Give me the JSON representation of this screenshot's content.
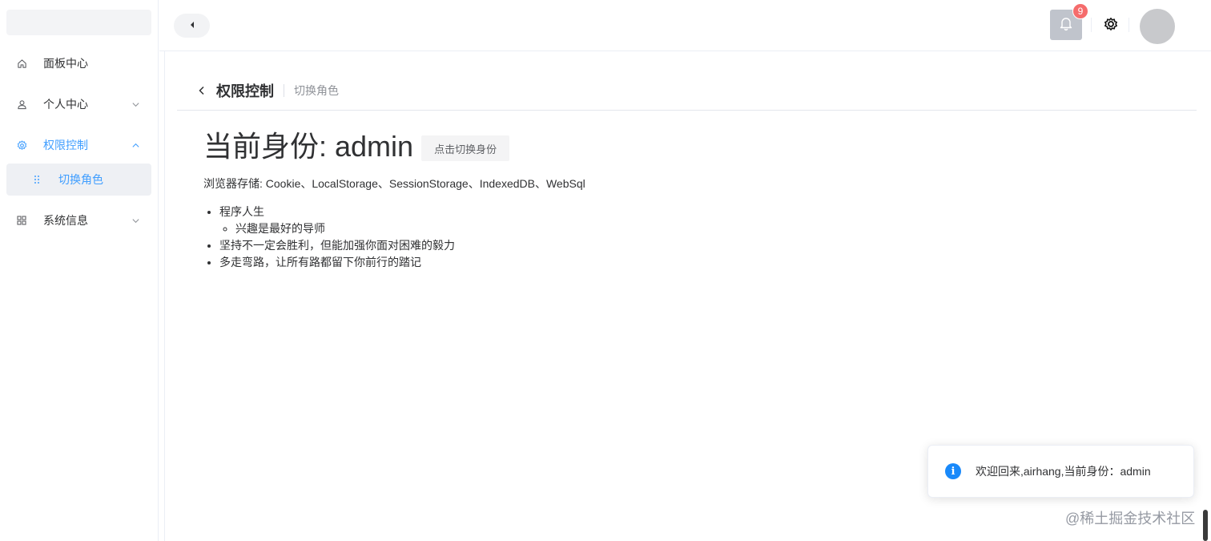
{
  "sidebar": {
    "items": [
      {
        "label": "面板中心",
        "icon": "home-icon"
      },
      {
        "label": "个人中心",
        "icon": "user-icon",
        "arrow": "chevron-down-icon"
      },
      {
        "label": "权限控制",
        "icon": "gear-icon",
        "arrow": "chevron-up-icon",
        "active": true
      },
      {
        "label": "系统信息",
        "icon": "grid-icon",
        "arrow": "chevron-down-icon"
      }
    ],
    "submenu": [
      {
        "label": "切换角色",
        "icon": "drag-dots-icon",
        "active": true
      }
    ]
  },
  "header": {
    "notification_count": "9"
  },
  "page_header": {
    "title": "权限控制",
    "subtitle": "切换角色"
  },
  "main": {
    "identity_title": "当前身份: admin",
    "switch_button": "点击切换身份",
    "storage_line": "浏览器存储: Cookie、LocalStorage、SessionStorage、IndexedDB、WebSql",
    "list": {
      "item1": "程序人生",
      "item1_sub": "兴趣是最好的导师",
      "item2": "坚持不一定会胜利，但能加强你面对困难的毅力",
      "item3": "多走弯路，让所有路都留下你前行的踏记"
    }
  },
  "notification": {
    "message": "欢迎回来,airhang,当前身份：admin"
  },
  "watermark": "@稀土掘金技术社区",
  "colors": {
    "accent": "#409eff",
    "badge": "#f56c6c",
    "info": "#1989fa"
  }
}
